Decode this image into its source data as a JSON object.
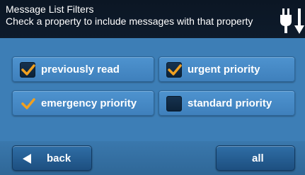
{
  "header": {
    "title": "Message List Filters",
    "subtitle": "Check a property to include messages with that property",
    "icon": "plug-icon"
  },
  "filters": [
    {
      "label": "previously read",
      "checked": true
    },
    {
      "label": "urgent priority",
      "checked": true
    },
    {
      "label": "emergency priority",
      "checked": true
    },
    {
      "label": "standard priority",
      "checked": false
    }
  ],
  "footer": {
    "back_label": "back",
    "back_icon": "left-arrow-icon",
    "all_label": "all"
  },
  "colors": {
    "accent_check": "#f0a020",
    "panel": "#3d7eb6",
    "header": "#0e1b2b"
  }
}
